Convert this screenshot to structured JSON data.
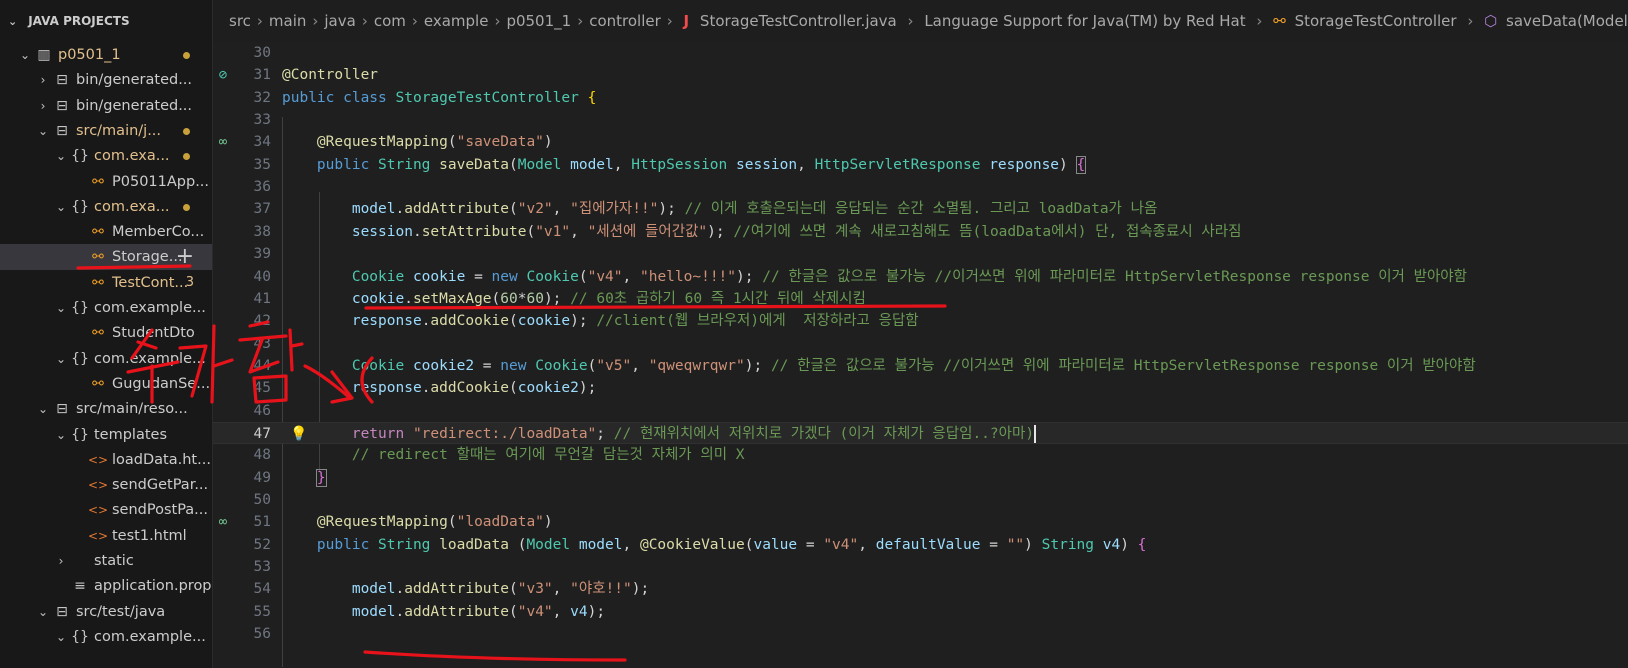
{
  "sidebar": {
    "title": "JAVA PROJECTS",
    "items": [
      {
        "label": "p0501_1",
        "icon": "project-icon",
        "twist": "open",
        "indent": 0,
        "color": "yellow",
        "dot": true
      },
      {
        "label": "bin/generated...",
        "icon": "package-folder-icon",
        "twist": "closed",
        "indent": 1
      },
      {
        "label": "bin/generated...",
        "icon": "package-folder-icon",
        "twist": "closed",
        "indent": 1
      },
      {
        "label": "src/main/j...",
        "icon": "package-folder-icon",
        "twist": "open",
        "indent": 1,
        "color": "yellow",
        "dot": true
      },
      {
        "label": "com.exa...",
        "icon": "package-icon",
        "twist": "open",
        "indent": 2,
        "color": "yellow",
        "dot": true
      },
      {
        "label": "P05011App...",
        "icon": "class-icon",
        "twist": "none",
        "indent": 3
      },
      {
        "label": "com.exa...",
        "icon": "package-icon",
        "twist": "open",
        "indent": 2,
        "color": "yellow",
        "dot": true
      },
      {
        "label": "MemberCo...",
        "icon": "class-icon",
        "twist": "none",
        "indent": 3
      },
      {
        "label": "Storage...",
        "icon": "class-icon",
        "twist": "none",
        "indent": 3,
        "selected": true,
        "plus": "+"
      },
      {
        "label": "TestCont...",
        "icon": "class-icon",
        "twist": "none",
        "indent": 3,
        "color": "yellow",
        "badge": "3"
      },
      {
        "label": "com.example...",
        "icon": "package-icon",
        "twist": "open",
        "indent": 2
      },
      {
        "label": "StudentDto",
        "icon": "class-icon",
        "twist": "none",
        "indent": 3
      },
      {
        "label": "com.example...",
        "icon": "package-icon",
        "twist": "open",
        "indent": 2
      },
      {
        "label": "GugudanSe...",
        "icon": "class-icon",
        "twist": "none",
        "indent": 3
      },
      {
        "label": "src/main/reso...",
        "icon": "package-folder-icon",
        "twist": "open",
        "indent": 1
      },
      {
        "label": "templates",
        "icon": "package-icon",
        "twist": "open",
        "indent": 2
      },
      {
        "label": "loadData.ht...",
        "icon": "html-icon",
        "twist": "none",
        "indent": 3
      },
      {
        "label": "sendGetPar...",
        "icon": "html-icon",
        "twist": "none",
        "indent": 3
      },
      {
        "label": "sendPostPa...",
        "icon": "html-icon",
        "twist": "none",
        "indent": 3
      },
      {
        "label": "test1.html",
        "icon": "html-icon",
        "twist": "none",
        "indent": 3
      },
      {
        "label": "static",
        "icon": "none",
        "twist": "closed",
        "indent": 2
      },
      {
        "label": "application.prop...",
        "icon": "lines-icon",
        "twist": "none",
        "indent": 2
      },
      {
        "label": "src/test/java",
        "icon": "package-folder-icon",
        "twist": "open",
        "indent": 1
      },
      {
        "label": "com.example...",
        "icon": "package-icon",
        "twist": "open",
        "indent": 2
      }
    ]
  },
  "breadcrumb": {
    "parts": [
      "src",
      "main",
      "java",
      "com",
      "example",
      "p0501_1",
      "controller"
    ],
    "file": "StorageTestController.java",
    "language": "Language Support for Java(TM) by Red Hat",
    "class": "StorageTestController",
    "method": "saveData(Model, HttpSession, H"
  },
  "editor": {
    "active_line": 47,
    "lines": [
      {
        "n": 30,
        "t": []
      },
      {
        "n": 31,
        "glyph": "noentry",
        "t": [
          [
            "ann",
            "@Controller"
          ]
        ]
      },
      {
        "n": 32,
        "t": [
          [
            "kw",
            "public class "
          ],
          [
            "cls",
            "StorageTestController"
          ],
          [
            "pl",
            " "
          ],
          [
            "brace",
            "{"
          ]
        ]
      },
      {
        "n": 33,
        "t": []
      },
      {
        "n": 34,
        "glyph": "link",
        "t": [
          [
            "pl",
            "    "
          ],
          [
            "ann",
            "@RequestMapping"
          ],
          [
            "pl",
            "("
          ],
          [
            "str",
            "\"saveData\""
          ],
          [
            "pl",
            ")"
          ]
        ]
      },
      {
        "n": 35,
        "t": [
          [
            "pl",
            "    "
          ],
          [
            "kw",
            "public "
          ],
          [
            "cls",
            "String "
          ],
          [
            "fn",
            "saveData"
          ],
          [
            "pl",
            "("
          ],
          [
            "cls",
            "Model "
          ],
          [
            "var",
            "model"
          ],
          [
            "pl",
            ", "
          ],
          [
            "cls",
            "HttpSession "
          ],
          [
            "var",
            "session"
          ],
          [
            "pl",
            ", "
          ],
          [
            "cls",
            "HttpServletResponse "
          ],
          [
            "var",
            "response"
          ],
          [
            "pl",
            ") "
          ],
          [
            "brace2box",
            "{"
          ]
        ]
      },
      {
        "n": 36,
        "t": []
      },
      {
        "n": 37,
        "t": [
          [
            "pl",
            "        "
          ],
          [
            "var",
            "model"
          ],
          [
            "pl",
            "."
          ],
          [
            "fn",
            "addAttribute"
          ],
          [
            "pl",
            "("
          ],
          [
            "str",
            "\"v2\""
          ],
          [
            "pl",
            ", "
          ],
          [
            "str",
            "\"집에가자!!\""
          ],
          [
            "pl",
            "); "
          ],
          [
            "com",
            "// 이게 호출은되는데 응답되는 순간 소멸됨. 그리고 loadData가 나옴"
          ]
        ]
      },
      {
        "n": 38,
        "t": [
          [
            "pl",
            "        "
          ],
          [
            "var",
            "session"
          ],
          [
            "pl",
            "."
          ],
          [
            "fn",
            "setAttribute"
          ],
          [
            "pl",
            "("
          ],
          [
            "str",
            "\"v1\""
          ],
          [
            "pl",
            ", "
          ],
          [
            "str",
            "\"세션에 들어간값\""
          ],
          [
            "pl",
            "); "
          ],
          [
            "com",
            "//여기에 쓰면 계속 새로고침해도 뜸(loadData에서) 단, 접속종료시 사라짐"
          ]
        ]
      },
      {
        "n": 39,
        "t": []
      },
      {
        "n": 40,
        "t": [
          [
            "pl",
            "        "
          ],
          [
            "cls",
            "Cookie "
          ],
          [
            "var",
            "cookie"
          ],
          [
            "pl",
            " = "
          ],
          [
            "kw",
            "new "
          ],
          [
            "cls",
            "Cookie"
          ],
          [
            "pl",
            "("
          ],
          [
            "str",
            "\"v4\""
          ],
          [
            "pl",
            ", "
          ],
          [
            "str",
            "\"hello~!!!\""
          ],
          [
            "pl",
            "); "
          ],
          [
            "com",
            "// 한글은 값으로 불가능 //이거쓰면 위에 파라미터로 HttpServletResponse response 이거 받아야함"
          ]
        ]
      },
      {
        "n": 41,
        "t": [
          [
            "pl",
            "        "
          ],
          [
            "var",
            "cookie"
          ],
          [
            "pl",
            "."
          ],
          [
            "fn",
            "setMaxAge"
          ],
          [
            "pl",
            "("
          ],
          [
            "num",
            "60"
          ],
          [
            "pl",
            "*"
          ],
          [
            "num",
            "60"
          ],
          [
            "pl",
            "); "
          ],
          [
            "com",
            "// 60초 곱하기 60 즉 1시간 뒤에 삭제시킴"
          ]
        ]
      },
      {
        "n": 42,
        "t": [
          [
            "pl",
            "        "
          ],
          [
            "var",
            "response"
          ],
          [
            "pl",
            "."
          ],
          [
            "fn",
            "addCookie"
          ],
          [
            "pl",
            "("
          ],
          [
            "var",
            "cookie"
          ],
          [
            "pl",
            "); "
          ],
          [
            "com",
            "//client(웹 브라우저)에게  저장하라고 응답함"
          ]
        ]
      },
      {
        "n": 43,
        "t": []
      },
      {
        "n": 44,
        "t": [
          [
            "pl",
            "        "
          ],
          [
            "cls",
            "Cookie "
          ],
          [
            "var",
            "cookie2"
          ],
          [
            "pl",
            " = "
          ],
          [
            "kw",
            "new "
          ],
          [
            "cls",
            "Cookie"
          ],
          [
            "pl",
            "("
          ],
          [
            "str",
            "\"v5\""
          ],
          [
            "pl",
            ", "
          ],
          [
            "str",
            "\"qweqwrqwr\""
          ],
          [
            "pl",
            "); "
          ],
          [
            "com",
            "// 한글은 값으로 불가능 //이거쓰면 위에 파라미터로 HttpServletResponse response 이거 받아야함"
          ]
        ]
      },
      {
        "n": 45,
        "t": [
          [
            "pl",
            "        "
          ],
          [
            "var",
            "response"
          ],
          [
            "pl",
            "."
          ],
          [
            "fn",
            "addCookie"
          ],
          [
            "pl",
            "("
          ],
          [
            "var",
            "cookie2"
          ],
          [
            "pl",
            ");"
          ]
        ]
      },
      {
        "n": 46,
        "t": []
      },
      {
        "n": 47,
        "glyph": "bulb",
        "t": [
          [
            "pl",
            "        "
          ],
          [
            "ret",
            "return "
          ],
          [
            "str",
            "\"redirect:./loadData\""
          ],
          [
            "pl",
            "; "
          ],
          [
            "com",
            "// 현재위치에서 저위치로 가겠다 (이거 자체가 응답임..?아마)"
          ],
          [
            "cursor",
            ""
          ]
        ]
      },
      {
        "n": 48,
        "t": [
          [
            "pl",
            "        "
          ],
          [
            "com",
            "// redirect 할때는 여기에 무언갈 담는것 자체가 의미 X"
          ]
        ]
      },
      {
        "n": 49,
        "t": [
          [
            "pl",
            "    "
          ],
          [
            "brace2box",
            "}"
          ]
        ]
      },
      {
        "n": 50,
        "t": []
      },
      {
        "n": 51,
        "glyph": "link",
        "t": [
          [
            "pl",
            "    "
          ],
          [
            "ann",
            "@RequestMapping"
          ],
          [
            "pl",
            "("
          ],
          [
            "str",
            "\"loadData\""
          ],
          [
            "pl",
            ")"
          ]
        ]
      },
      {
        "n": 52,
        "t": [
          [
            "pl",
            "    "
          ],
          [
            "kw",
            "public "
          ],
          [
            "cls",
            "String "
          ],
          [
            "fn",
            "loadData "
          ],
          [
            "pl",
            "("
          ],
          [
            "cls",
            "Model "
          ],
          [
            "var",
            "model"
          ],
          [
            "pl",
            ", "
          ],
          [
            "ann",
            "@CookieValue"
          ],
          [
            "pl",
            "("
          ],
          [
            "var",
            "value"
          ],
          [
            "pl",
            " = "
          ],
          [
            "str",
            "\"v4\""
          ],
          [
            "pl",
            ", "
          ],
          [
            "var",
            "defaultValue"
          ],
          [
            "pl",
            " = "
          ],
          [
            "str",
            "\"\""
          ],
          [
            "pl",
            ") "
          ],
          [
            "cls",
            "String "
          ],
          [
            "var",
            "v4"
          ],
          [
            "pl",
            ") "
          ],
          [
            "brace2",
            "{"
          ]
        ]
      },
      {
        "n": 53,
        "t": []
      },
      {
        "n": 54,
        "t": [
          [
            "pl",
            "        "
          ],
          [
            "var",
            "model"
          ],
          [
            "pl",
            "."
          ],
          [
            "fn",
            "addAttribute"
          ],
          [
            "pl",
            "("
          ],
          [
            "str",
            "\"v3\""
          ],
          [
            "pl",
            ", "
          ],
          [
            "str",
            "\"야호!!\""
          ],
          [
            "pl",
            ");"
          ]
        ]
      },
      {
        "n": 55,
        "t": [
          [
            "pl",
            "        "
          ],
          [
            "var",
            "model"
          ],
          [
            "pl",
            "."
          ],
          [
            "fn",
            "addAttribute"
          ],
          [
            "pl",
            "("
          ],
          [
            "str",
            "\"v4\""
          ],
          [
            "pl",
            ", "
          ],
          [
            "var",
            "v4"
          ],
          [
            "pl",
            ");"
          ]
        ]
      },
      {
        "n": 56,
        "t": []
      }
    ]
  },
  "annotation": {
    "text": "추가함",
    "color": "#e8121a"
  }
}
